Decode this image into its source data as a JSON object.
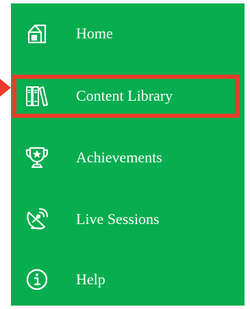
{
  "sidebar": {
    "items": [
      {
        "label": "Home",
        "icon": "home-icon"
      },
      {
        "label": "Content Library",
        "icon": "library-books-icon",
        "highlighted": true
      },
      {
        "label": "Achievements",
        "icon": "trophy-icon"
      },
      {
        "label": "Live Sessions",
        "icon": "satellite-dish-icon"
      },
      {
        "label": "Help",
        "icon": "info-icon"
      }
    ],
    "background_color": "#07ad4f",
    "text_color": "#ffffff"
  },
  "annotation": {
    "highlight_color": "#ee3b2b",
    "pointer": "arrow-pointer-icon"
  }
}
